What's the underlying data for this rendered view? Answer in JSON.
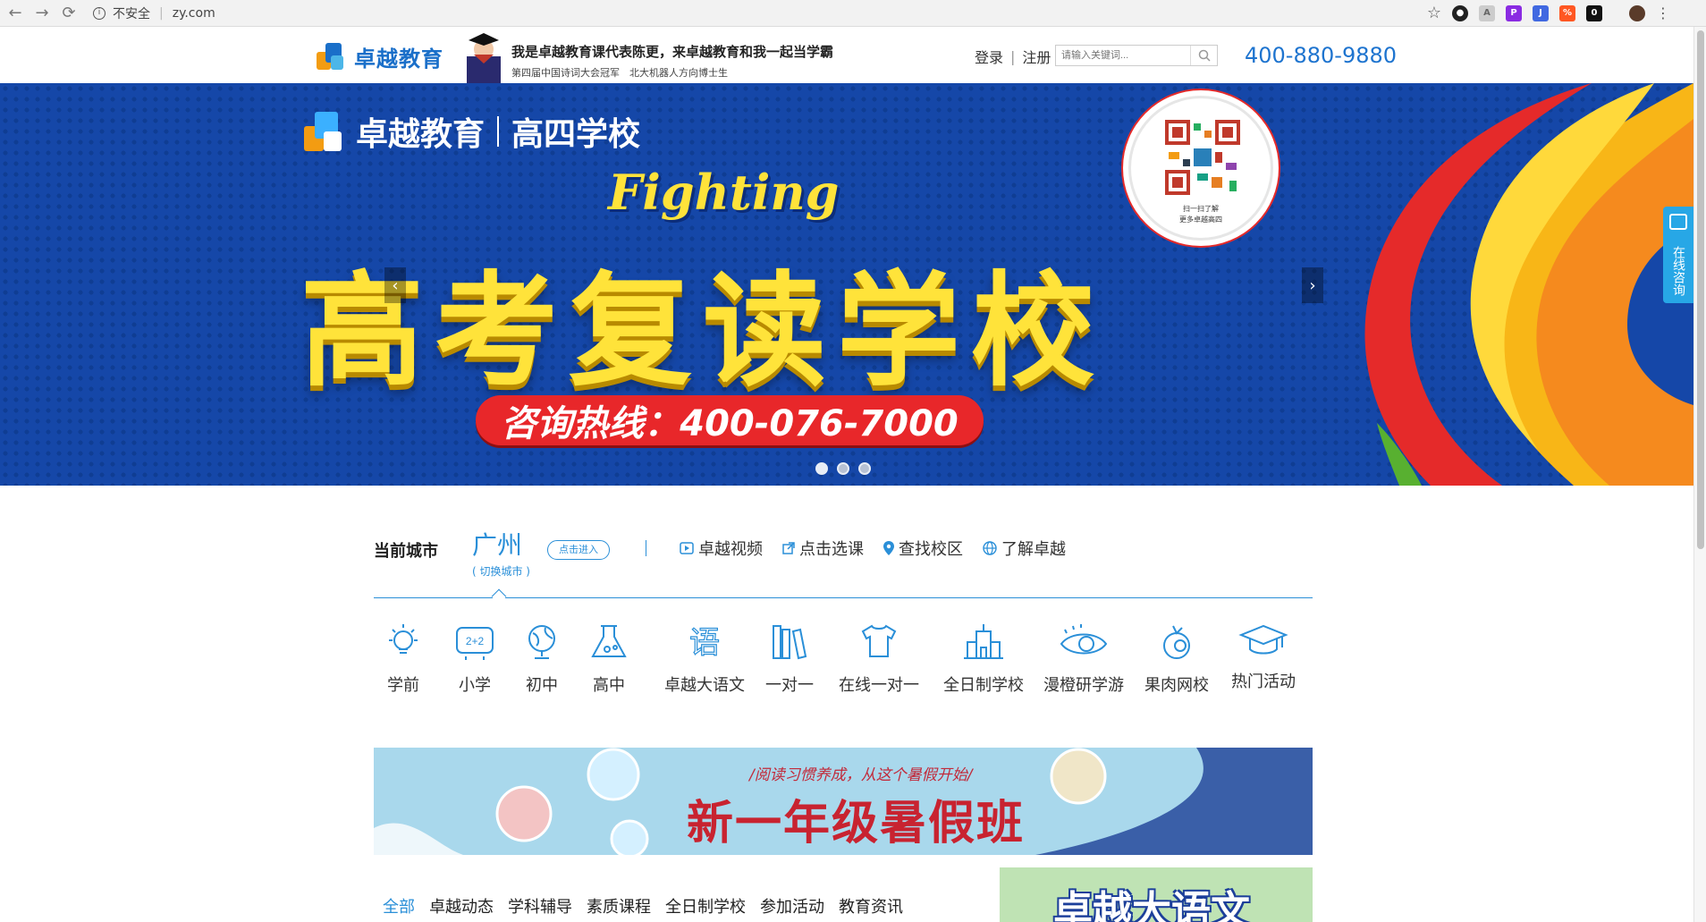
{
  "browser": {
    "security_label": "不安全",
    "url": "zy.com"
  },
  "header": {
    "logo_text": "卓越教育",
    "slogan_main": "我是卓越教育课代表陈更，来卓越教育和我一起当学霸",
    "slogan_sub": "第四届中国诗词大会冠军　北大机器人方向博士生",
    "login": "登录",
    "register": "注册",
    "search_placeholder": "请输入关键词...",
    "hotline": "400-880-9880"
  },
  "banner": {
    "logo_text": "卓越教育",
    "school": "高四学校",
    "fighting": "Fighting",
    "title": "高考复读学校",
    "hotline": "咨询热线：400-076-7000",
    "qr_caption_1": "扫一扫了解",
    "qr_caption_2": "更多卓越高四",
    "prev": "‹",
    "next": "›",
    "slides": 3,
    "active_slide": 1
  },
  "consult": {
    "label": "在线咨询"
  },
  "city": {
    "label": "当前城市",
    "name": "广州",
    "switch": "( 切换城市 )",
    "enter": "点击进入",
    "links": [
      "卓越视频",
      "点击选课",
      "查找校区",
      "了解卓越"
    ]
  },
  "categories": [
    {
      "label": "学前",
      "icon": "bulb-icon"
    },
    {
      "label": "小学",
      "icon": "blackboard-icon"
    },
    {
      "label": "初中",
      "icon": "globe-icon"
    },
    {
      "label": "高中",
      "icon": "flask-icon"
    },
    {
      "label": "卓越大语文",
      "icon": "chinese-char-icon"
    },
    {
      "label": "一对一",
      "icon": "books-icon"
    },
    {
      "label": "在线一对一",
      "icon": "shirt-icon"
    },
    {
      "label": "全日制学校",
      "icon": "building-icon"
    },
    {
      "label": "漫橙研学游",
      "icon": "eye-icon"
    },
    {
      "label": "果肉网校",
      "icon": "fruit-icon"
    },
    {
      "label": "热门活动",
      "icon": "graduation-cap-icon"
    }
  ],
  "promo": {
    "sub": "/阅读习惯养成，从这个暑假开始/",
    "main": "新一年级暑假班"
  },
  "news": {
    "tabs": [
      "全部",
      "卓越动态",
      "学科辅导",
      "素质课程",
      "全日制学校",
      "参加活动",
      "教育资讯"
    ]
  },
  "side_promo": {
    "title": "卓越大语文"
  },
  "colors": {
    "brand_blue": "#2a8fd8",
    "banner_blue": "#1547a8",
    "banner_yellow": "#ffe33a",
    "hotline_red": "#e8272a"
  }
}
